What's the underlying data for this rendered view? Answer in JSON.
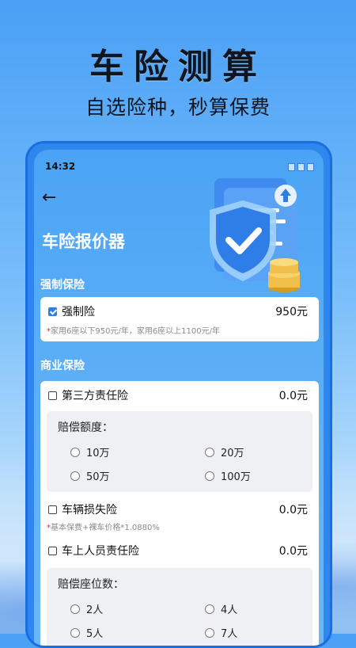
{
  "hero": {
    "title": "车险测算",
    "subtitle": "自选险种，秒算保费"
  },
  "status_bar": {
    "time": "14:32"
  },
  "app": {
    "title": "车险报价器"
  },
  "compulsory": {
    "section_label": "强制保险",
    "item": {
      "label": "强制险",
      "price": "950元",
      "checked": true,
      "note": "家用6座以下950元/年，家用6座以上1100元/年"
    }
  },
  "commercial": {
    "section_label": "商业保险",
    "third_party": {
      "label": "第三方责任险",
      "price": "0.0元",
      "checked": false,
      "options_title": "赔偿额度：",
      "options": [
        "10万",
        "20万",
        "50万",
        "100万"
      ]
    },
    "vehicle_loss": {
      "label": "车辆损失险",
      "price": "0.0元",
      "checked": false,
      "note": "基本保费+裸车价格*1.0880%"
    },
    "passenger": {
      "label": "车上人员责任险",
      "price": "0.0元",
      "checked": false,
      "options_title": "赔偿座位数：",
      "options": [
        "2人",
        "4人",
        "5人",
        "7人"
      ]
    }
  },
  "colors": {
    "accent": "#2f7ee8",
    "note_star": "#e23333",
    "price_text": "#111111"
  }
}
